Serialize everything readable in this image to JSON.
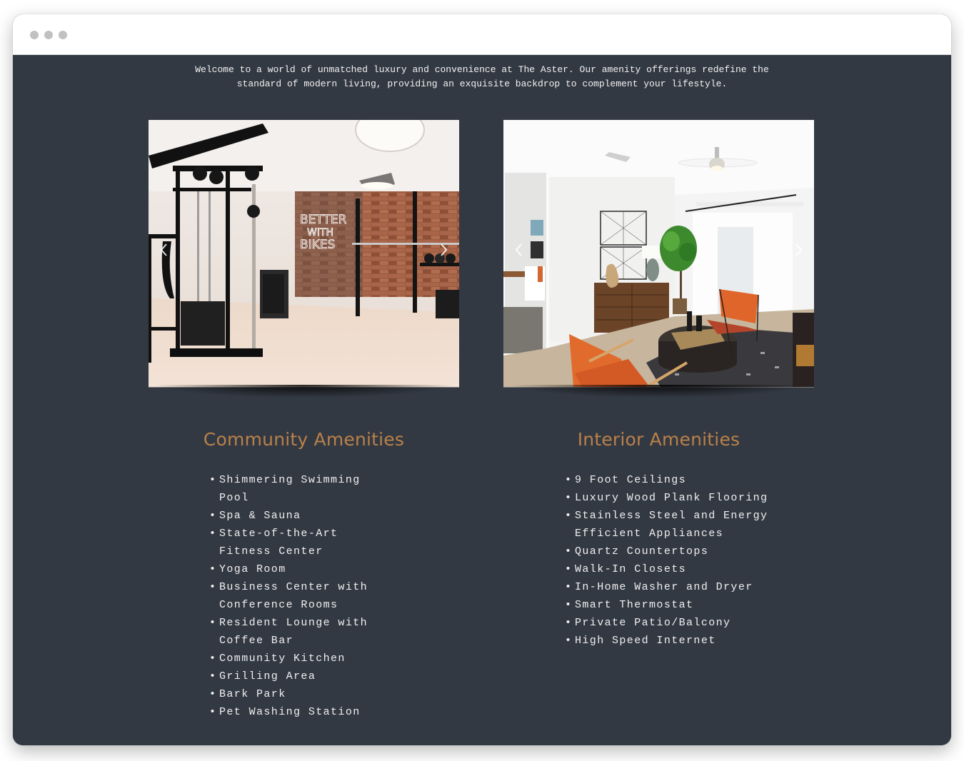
{
  "window": {
    "controls": [
      "close-dot",
      "minimize-dot",
      "maximize-dot"
    ]
  },
  "intro": {
    "line1": "Welcome to a world of unmatched luxury and convenience at The Aster. Our amenity offerings redefine the",
    "line2": "standard of modern living, providing an exquisite backdrop to complement your lifestyle."
  },
  "gallery": {
    "left": {
      "alt": "Fitness center with cable machine, squat rack and brick wall with neon sign",
      "neon_text": "BETTER WITH BIKES",
      "prev_icon": "chevron-left-icon",
      "next_icon": "chevron-right-icon"
    },
    "right": {
      "alt": "Living room with orange chairs, round coffee table, wood dresser and fiddle-leaf fig",
      "prev_icon": "chevron-left-icon",
      "next_icon": "chevron-right-icon"
    }
  },
  "community": {
    "title": "Community Amenities",
    "items": [
      "Shimmering Swimming Pool",
      "Spa & Sauna",
      "State-of-the-Art Fitness Center",
      "Yoga Room",
      "Business Center with Conference Rooms",
      "Resident Lounge with Coffee Bar",
      "Community Kitchen",
      "Grilling Area",
      "Bark Park",
      "Pet Washing Station"
    ]
  },
  "interior": {
    "title": "Interior Amenities",
    "items": [
      "9 Foot Ceilings",
      "Luxury Wood Plank Flooring",
      "Stainless Steel and Energy Efficient Appliances",
      "Quartz Countertops",
      "Walk-In Closets",
      "In-Home Washer and Dryer",
      "Smart Thermostat",
      "Private Patio/Balcony",
      "High Speed Internet"
    ]
  },
  "colors": {
    "background": "#333943",
    "heading_accent": "#b9814a",
    "text": "#f0f0f0"
  }
}
